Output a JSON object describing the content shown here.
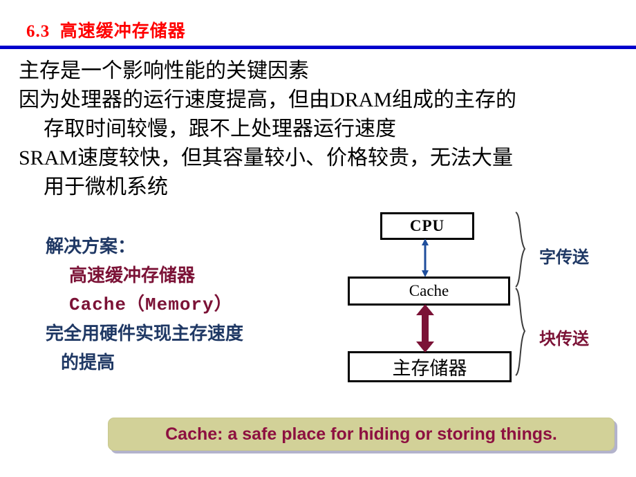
{
  "slide": {
    "title": "6.3  高速缓冲存储器",
    "title_color": "#ff0000",
    "rule_color": "#0000cc"
  },
  "body": {
    "lines": [
      {
        "text": "主存是一个影响性能的关键因素",
        "indent": false
      },
      {
        "text": "因为处理器的运行速度提高，但由DRAM组成的主存的",
        "indent": false
      },
      {
        "text": "存取时间较慢，跟不上处理器运行速度",
        "indent": true
      },
      {
        "text": "SRAM速度较快，但其容量较小、价格较贵，无法大量",
        "indent": false
      },
      {
        "text": "用于微机系统",
        "indent": true
      }
    ]
  },
  "solution": {
    "heading": "解决方案：",
    "heading_color": "#1f3864",
    "items": [
      {
        "text": "高速缓冲存储器",
        "style": "dark",
        "color": "#7b1236",
        "indent": 1
      },
      {
        "text": "Cache（Memory）",
        "style": "mono",
        "color": "#7b1236",
        "indent": 1
      },
      {
        "text": "完全用硬件实现主存速度",
        "style": "navy",
        "color": "#1f3864",
        "indent": 0
      },
      {
        "text": "的提高",
        "style": "navy",
        "color": "#1f3864",
        "indent": 2
      }
    ]
  },
  "diagram": {
    "boxes": [
      {
        "id": "cpu",
        "label": "CPU"
      },
      {
        "id": "cache",
        "label": "Cache"
      },
      {
        "id": "mem",
        "label": "主存储器"
      }
    ],
    "arrows": [
      {
        "id": "word-transfer-arrow",
        "color": "#1f4e9c",
        "direction": "double-vertical"
      },
      {
        "id": "block-transfer-arrow",
        "color": "#7b1236",
        "direction": "double-vertical"
      }
    ],
    "brace_labels": [
      {
        "id": "word",
        "text": "字传送",
        "color": "#1f3864"
      },
      {
        "id": "block",
        "text": "块传送",
        "color": "#7b1236"
      }
    ]
  },
  "banner": {
    "text": "Cache: a safe place for hiding or storing things.",
    "text_color": "#8d1040",
    "background_color": "#d2d198"
  }
}
